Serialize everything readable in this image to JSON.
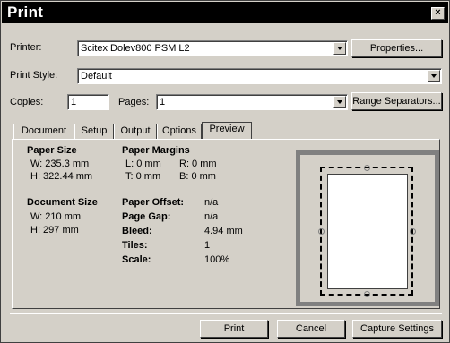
{
  "window": {
    "title": "Print",
    "close_glyph": "×"
  },
  "printer": {
    "label": "Printer:",
    "value": "Scitex Dolev800 PSM L2",
    "properties_label": "Properties..."
  },
  "style": {
    "label": "Print Style:",
    "value": "Default"
  },
  "copies": {
    "label": "Copies:",
    "value": "1"
  },
  "pages": {
    "label": "Pages:",
    "value": "1",
    "range_label": "Range Separators..."
  },
  "tabs": [
    {
      "label": "Document"
    },
    {
      "label": "Setup"
    },
    {
      "label": "Output"
    },
    {
      "label": "Options"
    },
    {
      "label": "Preview"
    }
  ],
  "preview": {
    "paper_size": {
      "heading": "Paper Size",
      "w": "W: 235.3 mm",
      "h": "H: 322.44 mm"
    },
    "paper_margins": {
      "heading": "Paper Margins",
      "l": "L: 0 mm",
      "r": "R: 0 mm",
      "t": "T: 0 mm",
      "b": "B: 0 mm"
    },
    "document_size": {
      "heading": "Document Size",
      "w": "W: 210 mm",
      "h": "H: 297 mm"
    },
    "stats": [
      {
        "key": "Paper Offset:",
        "value": "n/a"
      },
      {
        "key": "Page Gap:",
        "value": "n/a"
      },
      {
        "key": "Bleed:",
        "value": "4.94 mm"
      },
      {
        "key": "Tiles:",
        "value": "1"
      },
      {
        "key": "Scale:",
        "value": "100%"
      }
    ]
  },
  "buttons": {
    "print": "Print",
    "cancel": "Cancel",
    "capture": "Capture Settings"
  }
}
